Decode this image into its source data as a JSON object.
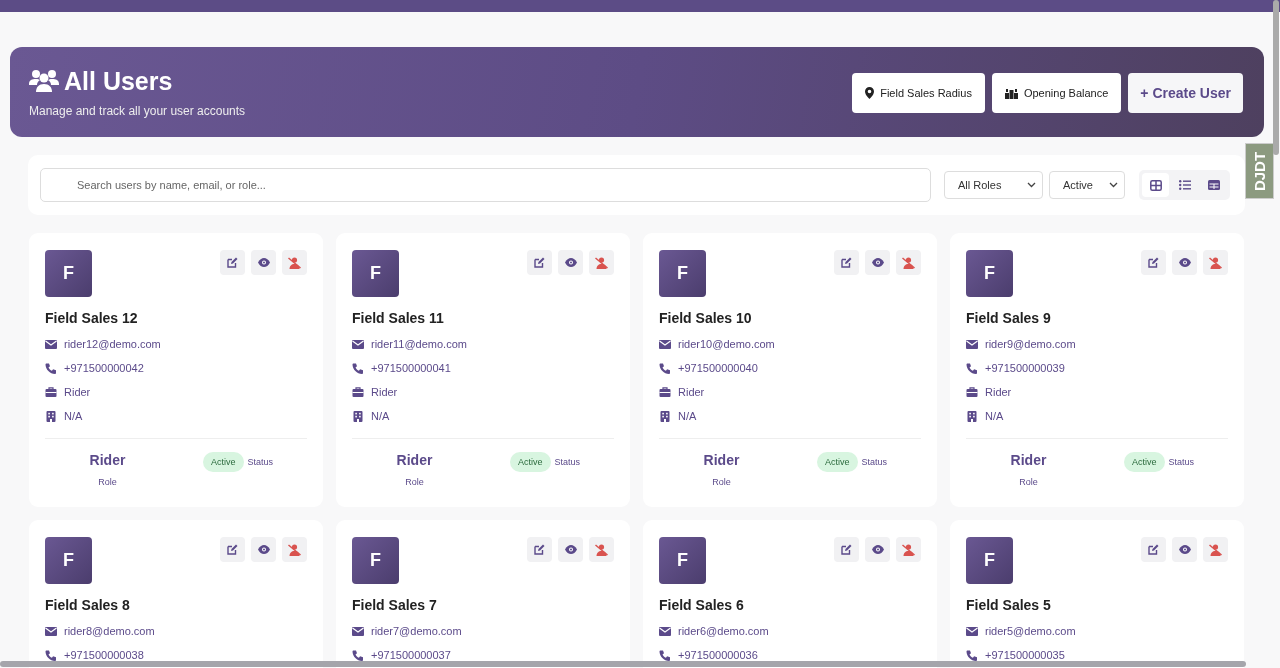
{
  "header": {
    "title": "All Users",
    "subtitle": "Manage and track all your user accounts",
    "buttons": [
      {
        "kind": "radius",
        "label": "Field Sales Radius"
      },
      {
        "kind": "balance",
        "label": "Opening Balance"
      },
      {
        "kind": "create",
        "label": "+ Create User"
      }
    ]
  },
  "filters": {
    "search": {
      "placeholder": "Search users by name, email, or role..."
    },
    "role": "All Roles",
    "status": "Active",
    "views": [
      {
        "kind": "grid",
        "selected": true
      },
      {
        "kind": "list",
        "selected": false
      },
      {
        "kind": "table",
        "selected": false
      }
    ]
  },
  "debug_tab": "DJDT",
  "users": [
    {
      "initial": "F",
      "name": "Field Sales 12",
      "email": "rider12@demo.com",
      "phone": "+971500000042",
      "role": "Rider",
      "branch": "N/A",
      "footer": {
        "role": "Rider",
        "role_label": "Role",
        "status": "Active",
        "status_label": "Status"
      }
    },
    {
      "initial": "F",
      "name": "Field Sales 11",
      "email": "rider11@demo.com",
      "phone": "+971500000041",
      "role": "Rider",
      "branch": "N/A",
      "footer": {
        "role": "Rider",
        "role_label": "Role",
        "status": "Active",
        "status_label": "Status"
      }
    },
    {
      "initial": "F",
      "name": "Field Sales 10",
      "email": "rider10@demo.com",
      "phone": "+971500000040",
      "role": "Rider",
      "branch": "N/A",
      "footer": {
        "role": "Rider",
        "role_label": "Role",
        "status": "Active",
        "status_label": "Status"
      }
    },
    {
      "initial": "F",
      "name": "Field Sales 9",
      "email": "rider9@demo.com",
      "phone": "+971500000039",
      "role": "Rider",
      "branch": "N/A",
      "footer": {
        "role": "Rider",
        "role_label": "Role",
        "status": "Active",
        "status_label": "Status"
      }
    },
    {
      "initial": "F",
      "name": "Field Sales 8",
      "email": "rider8@demo.com",
      "phone": "+971500000038"
    },
    {
      "initial": "F",
      "name": "Field Sales 7",
      "email": "rider7@demo.com",
      "phone": "+971500000037"
    },
    {
      "initial": "F",
      "name": "Field Sales 6",
      "email": "rider6@demo.com",
      "phone": "+971500000036"
    },
    {
      "initial": "F",
      "name": "Field Sales 5",
      "email": "rider5@demo.com",
      "phone": "+971500000035"
    }
  ]
}
